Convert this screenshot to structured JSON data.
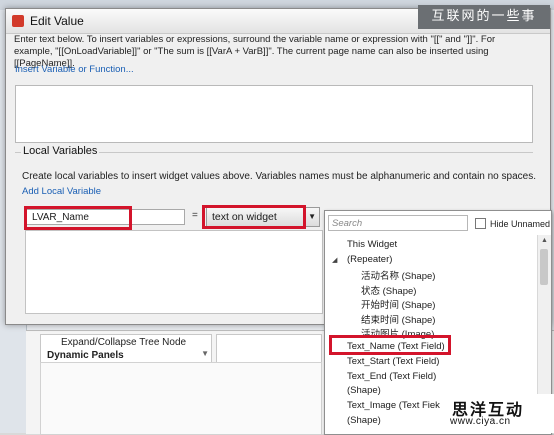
{
  "dialog": {
    "title": "Edit Value",
    "instructions": "Enter text below. To insert variables or expressions, surround the variable name or expression with \"[[\" and \"]]\". For example, \"[[OnLoadVariable]]\" or \"The sum is [[VarA + VarB]]\". The current page name can also be inserted using [[PageName]].",
    "insert_link": "Insert Variable or Function...",
    "local_vars": {
      "legend": "Local Variables",
      "description": "Create local variables to insert widget values above. Variables names must be alphanumeric and contain no spaces.",
      "add_link": "Add Local Variable",
      "name_value": "LVAR_Name",
      "equals": "=",
      "type_value": "text on widget"
    }
  },
  "popup": {
    "search_placeholder": "Search",
    "hide_unnamed_label": "Hide Unnamed",
    "items": [
      {
        "label": "This Widget"
      },
      {
        "label": "(Repeater)"
      },
      {
        "label": "活动名称 (Shape)"
      },
      {
        "label": "状态 (Shape)"
      },
      {
        "label": "开始时间 (Shape)"
      },
      {
        "label": "结束时间 (Shape)"
      },
      {
        "label": "活动图片 (Image)"
      },
      {
        "label": "Text_Name (Text Field)"
      },
      {
        "label": "Text_Start (Text Field)"
      },
      {
        "label": "Text_End (Text Field)"
      },
      {
        "label": "(Shape)"
      },
      {
        "label": "Text_Image (Text Fiek"
      },
      {
        "label": "(Shape)"
      }
    ]
  },
  "background": {
    "tree_row1": "Expand/Collapse Tree Node",
    "tree_row2": "Dynamic Panels"
  },
  "watermarks": {
    "top": "互联网的一些事",
    "bottom_cn": "思洋互动",
    "bottom_url": "www.ciya.cn"
  },
  "colors": {
    "highlight_red": "#d3142b",
    "link_blue": "#1a5fb4"
  }
}
